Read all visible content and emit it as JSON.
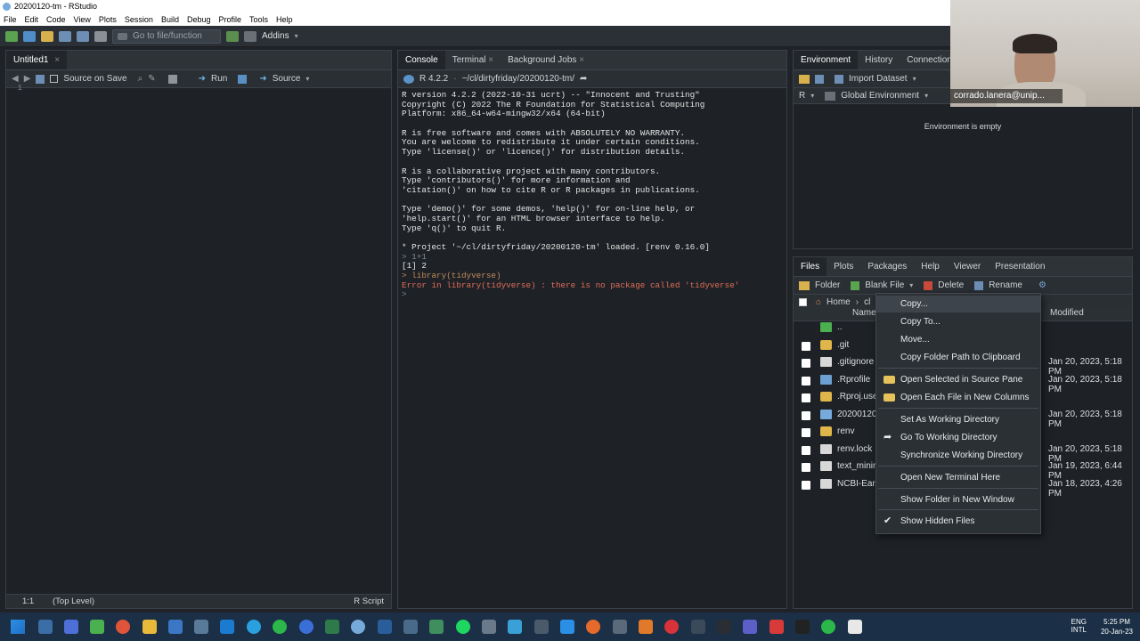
{
  "window": {
    "title": "20200120-tm - RStudio"
  },
  "menubar": [
    "File",
    "Edit",
    "Code",
    "View",
    "Plots",
    "Session",
    "Build",
    "Debug",
    "Profile",
    "Tools",
    "Help"
  ],
  "toolbar": {
    "goto_placeholder": "Go to file/function",
    "addins_label": "Addins"
  },
  "source_pane": {
    "tab_label": "Untitled1",
    "source_on_save": "Source on Save",
    "run_label": "Run",
    "source_label": "Source",
    "line_number": "1",
    "status_position": "1:1",
    "status_scope": "(Top Level)",
    "status_type": "R Script"
  },
  "console_pane": {
    "tabs": [
      "Console",
      "Terminal",
      "Background Jobs"
    ],
    "r_version": "R 4.2.2",
    "path": "~/cl/dirtyfriday/20200120-tm/",
    "lines": [
      {
        "text": "R version 4.2.2 (2022-10-31 ucrt) -- \"Innocent and Trusting\"",
        "kind": "out"
      },
      {
        "text": "Copyright (C) 2022 The R Foundation for Statistical Computing",
        "kind": "out"
      },
      {
        "text": "Platform: x86_64-w64-mingw32/x64 (64-bit)",
        "kind": "out"
      },
      {
        "text": "",
        "kind": "out"
      },
      {
        "text": "R is free software and comes with ABSOLUTELY NO WARRANTY.",
        "kind": "out"
      },
      {
        "text": "You are welcome to redistribute it under certain conditions.",
        "kind": "out"
      },
      {
        "text": "Type 'license()' or 'licence()' for distribution details.",
        "kind": "out"
      },
      {
        "text": "",
        "kind": "out"
      },
      {
        "text": "R is a collaborative project with many contributors.",
        "kind": "out"
      },
      {
        "text": "Type 'contributors()' for more information and",
        "kind": "out"
      },
      {
        "text": "'citation()' on how to cite R or R packages in publications.",
        "kind": "out"
      },
      {
        "text": "",
        "kind": "out"
      },
      {
        "text": "Type 'demo()' for some demos, 'help()' for on-line help, or",
        "kind": "out"
      },
      {
        "text": "'help.start()' for an HTML browser interface to help.",
        "kind": "out"
      },
      {
        "text": "Type 'q()' to quit R.",
        "kind": "out"
      },
      {
        "text": "",
        "kind": "out"
      },
      {
        "text": "* Project '~/cl/dirtyfriday/20200120-tm' loaded. [renv 0.16.0]",
        "kind": "out"
      },
      {
        "text": "> 1+1",
        "kind": "prompt"
      },
      {
        "text": "[1] 2",
        "kind": "out"
      },
      {
        "text": "> library(tidyverse)",
        "kind": "cmd"
      },
      {
        "text": "Error in library(tidyverse) : there is no package called 'tidyverse'",
        "kind": "err"
      },
      {
        "text": "> ",
        "kind": "prompt"
      }
    ]
  },
  "env_pane": {
    "tabs": [
      "Environment",
      "History",
      "Connections"
    ],
    "import_label": "Import Dataset",
    "lang": "R",
    "scope": "Global Environment",
    "empty_msg": "Environment is empty"
  },
  "files_pane": {
    "tabs": [
      "Files",
      "Plots",
      "Packages",
      "Help",
      "Viewer",
      "Presentation"
    ],
    "folder_label": "Folder",
    "blank_file_label": "Blank File",
    "delete_label": "Delete",
    "rename_label": "Rename",
    "breadcrumb_home": "Home",
    "breadcrumb_next": "cl",
    "col_name": "Name",
    "col_modified": "Modified",
    "rows": [
      {
        "name": "..",
        "modified": "",
        "icon": "up-arrow"
      },
      {
        "name": ".git",
        "modified": "",
        "icon": "folder"
      },
      {
        "name": ".gitignore",
        "modified": "Jan 20, 2023, 5:18 PM",
        "icon": "file"
      },
      {
        "name": ".Rprofile",
        "modified": "Jan 20, 2023, 5:18 PM",
        "icon": "rfile"
      },
      {
        "name": ".Rproj.use",
        "modified": "",
        "icon": "folder"
      },
      {
        "name": "20200120",
        "modified": "Jan 20, 2023, 5:18 PM",
        "icon": "rproj"
      },
      {
        "name": "renv",
        "modified": "",
        "icon": "folder"
      },
      {
        "name": "renv.lock",
        "modified": "Jan 20, 2023, 5:18 PM",
        "icon": "file"
      },
      {
        "name": "text_minir",
        "modified": "Jan 19, 2023, 6:44 PM",
        "icon": "file"
      },
      {
        "name": "NCBI-EarA",
        "modified": "Jan 18, 2023, 4:26 PM",
        "icon": "file"
      }
    ]
  },
  "context_menu": [
    {
      "label": "Copy...",
      "icon": ""
    },
    {
      "label": "Copy To...",
      "icon": ""
    },
    {
      "label": "Move...",
      "icon": ""
    },
    {
      "label": "Copy Folder Path to Clipboard",
      "icon": ""
    },
    {
      "label": "Open Selected in Source Pane",
      "icon": "open-folder"
    },
    {
      "label": "Open Each File in New Columns",
      "icon": "open-folder"
    },
    {
      "label": "Set As Working Directory",
      "icon": ""
    },
    {
      "label": "Go To Working Directory",
      "icon": "goto-arrow"
    },
    {
      "label": "Synchronize Working Directory",
      "icon": ""
    },
    {
      "label": "Open New Terminal Here",
      "icon": ""
    },
    {
      "label": "Show Folder in New Window",
      "icon": ""
    },
    {
      "label": "Show Hidden Files",
      "icon": "check"
    }
  ],
  "webcam": {
    "name": "corrado.lanera@unip..."
  },
  "taskbar": {
    "lang1": "ENG",
    "lang2": "INTL",
    "time": "5:25 PM",
    "date": "20-Jan-23"
  }
}
